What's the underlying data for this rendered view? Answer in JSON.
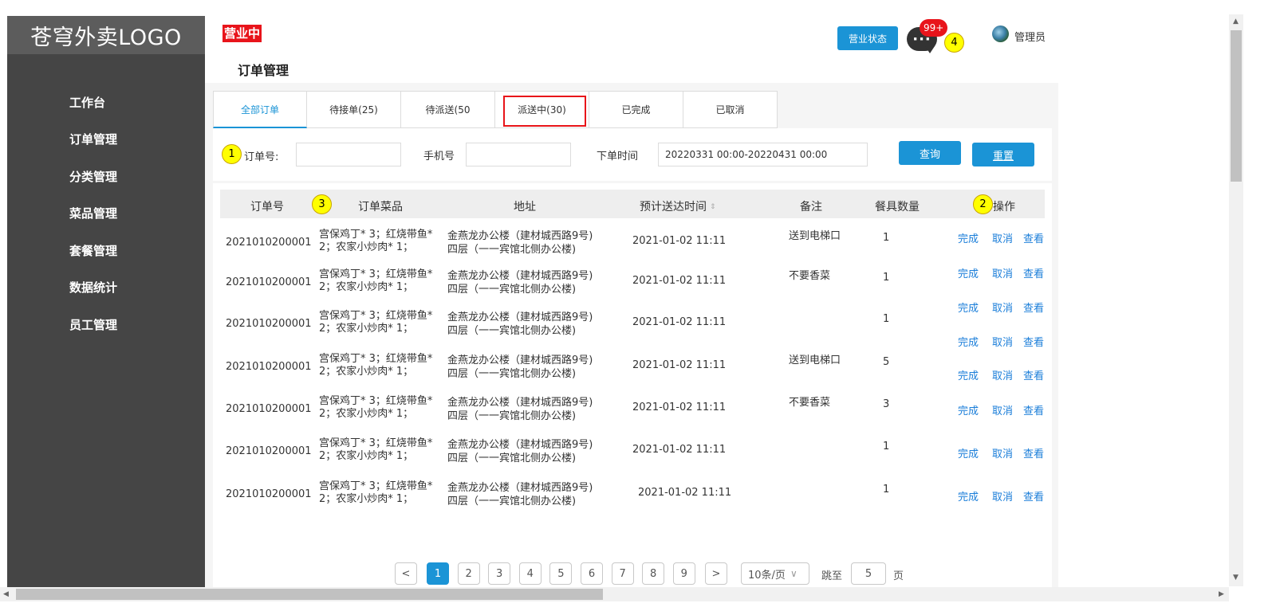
{
  "app": {
    "logo": "苍穹外卖LOGO",
    "status_tag": "营业中",
    "page_title": "订单管理",
    "biz_status_button": "营业状态",
    "msg_badge": "99+",
    "msg_icon_glyph": "···",
    "admin_name": "管理员"
  },
  "sidebar": {
    "items": [
      "工作台",
      "订单管理",
      "分类管理",
      "菜品管理",
      "套餐管理",
      "数据统计",
      "员工管理"
    ]
  },
  "markers": [
    "1",
    "2",
    "3",
    "4"
  ],
  "tabs": [
    "全部订单",
    "待接单(25)",
    "待派送(50",
    "派送中(30)",
    "已完成",
    "已取消"
  ],
  "filter": {
    "order_no_label": "订单号:",
    "order_no_value": "",
    "phone_label": "手机号",
    "phone_value": "",
    "time_label": "下单时间",
    "time_value": "20220331 00:00-20220431 00:00",
    "query_button": "查询",
    "reset_button": "重置"
  },
  "table": {
    "headers": [
      "订单号",
      "订单菜品",
      "地址",
      "预计送达时间",
      "备注",
      "餐具数量",
      "操作"
    ],
    "sort_icon": "⇕",
    "rows": [
      {
        "order_no": "2021010200001",
        "dishes_1": "宫保鸡丁* 3；红烧带鱼*",
        "dishes_2": "2；农家小炒肉* 1；",
        "addr_1": "金燕龙办公楼（建材城西路9号)",
        "addr_2": "四层（一一宾馆北侧办公楼)",
        "time": "2021-01-02 11:11",
        "note": "送到电梯口",
        "qty": "1"
      },
      {
        "order_no": "2021010200001",
        "dishes_1": "宫保鸡丁* 3；红烧带鱼*",
        "dishes_2": "2；农家小炒肉* 1；",
        "addr_1": "金燕龙办公楼（建材城西路9号)",
        "addr_2": "四层（一一宾馆北侧办公楼)",
        "time": "2021-01-02 11:11",
        "note": "不要香菜",
        "qty": "1"
      },
      {
        "order_no": "2021010200001",
        "dishes_1": "宫保鸡丁* 3；红烧带鱼*",
        "dishes_2": "2；农家小炒肉* 1；",
        "addr_1": "金燕龙办公楼（建材城西路9号)",
        "addr_2": "四层（一一宾馆北侧办公楼)",
        "time": "2021-01-02 11:11",
        "note": "",
        "qty": "1"
      },
      {
        "order_no": "2021010200001",
        "dishes_1": "宫保鸡丁* 3；红烧带鱼*",
        "dishes_2": "2；农家小炒肉* 1；",
        "addr_1": "金燕龙办公楼（建材城西路9号)",
        "addr_2": "四层（一一宾馆北侧办公楼)",
        "time": "2021-01-02 11:11",
        "note": "送到电梯口",
        "qty": "5"
      },
      {
        "order_no": "2021010200001",
        "dishes_1": "宫保鸡丁* 3；红烧带鱼*",
        "dishes_2": "2；农家小炒肉* 1；",
        "addr_1": "金燕龙办公楼（建材城西路9号)",
        "addr_2": "四层（一一宾馆北侧办公楼)",
        "time": "2021-01-02 11:11",
        "note": "不要香菜",
        "qty": "3"
      },
      {
        "order_no": "2021010200001",
        "dishes_1": "宫保鸡丁* 3；红烧带鱼*",
        "dishes_2": "2；农家小炒肉* 1；",
        "addr_1": "金燕龙办公楼（建材城西路9号)",
        "addr_2": "四层（一一宾馆北侧办公楼)",
        "time": "2021-01-02 11:11",
        "note": "",
        "qty": "1"
      },
      {
        "order_no": "2021010200001",
        "dishes_1": "宫保鸡丁* 3；红烧带鱼*",
        "dishes_2": "2；农家小炒肉* 1；",
        "addr_1": "金燕龙办公楼（建材城西路9号)",
        "addr_2": "四层（一一宾馆北侧办公楼)",
        "time": "2021-01-02 11:11",
        "note": "",
        "qty": "1"
      }
    ],
    "actions": {
      "complete": "完成",
      "cancel": "取消",
      "view": "查看"
    },
    "action_rows": 9
  },
  "pagination": {
    "prev": "<",
    "next": ">",
    "pages": [
      "1",
      "2",
      "3",
      "4",
      "5",
      "6",
      "7",
      "8",
      "9"
    ],
    "current": "1",
    "page_size": "10条/页",
    "dropdown_icon": "∨",
    "jump_label": "跳至",
    "jump_value": "5",
    "page_unit": "页"
  },
  "colors": {
    "accent": "#1b94d6",
    "sidebar": "#454545",
    "status_red": "#e8141b",
    "marker": "#ffff00"
  }
}
